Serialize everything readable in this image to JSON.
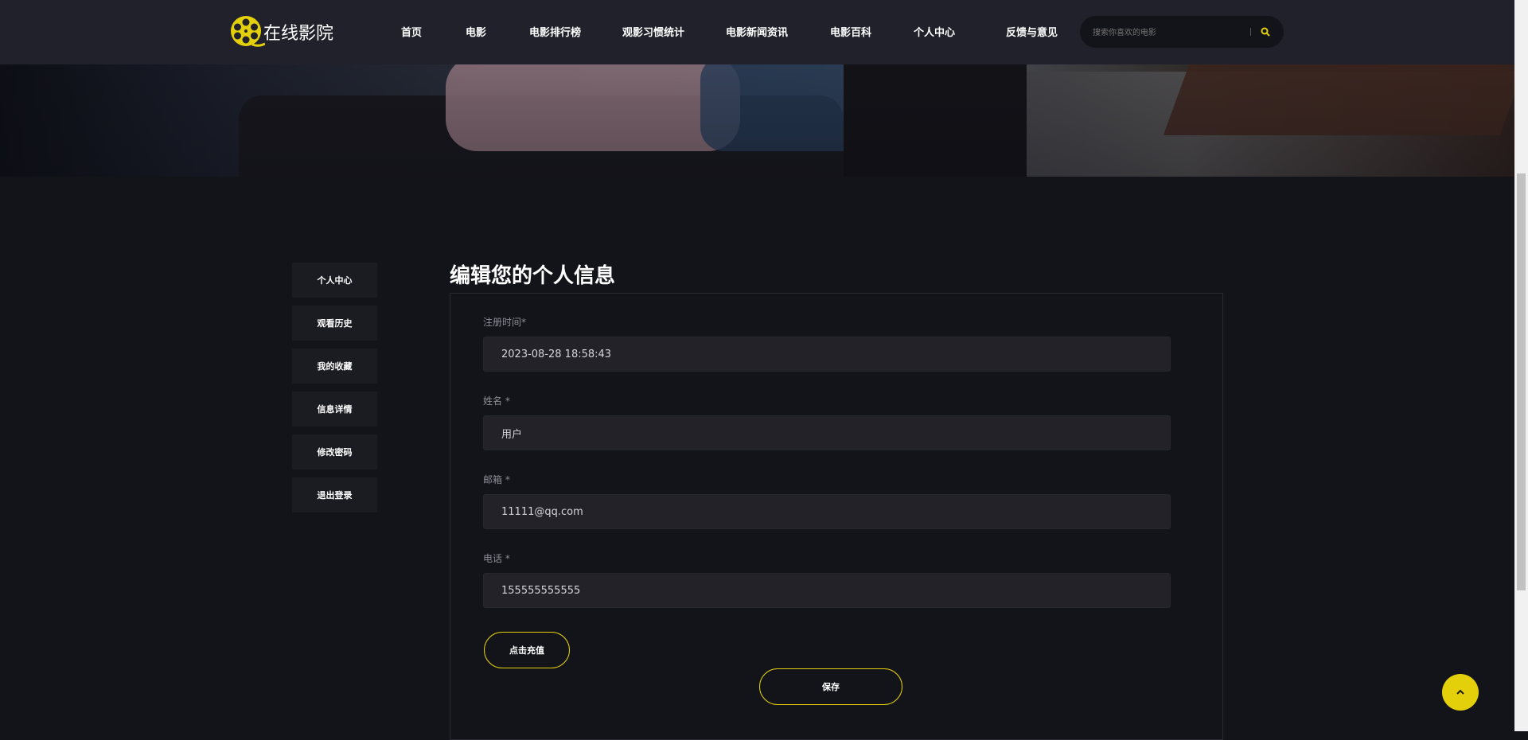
{
  "brand": {
    "name": "在线影院",
    "accent": "#e4d00a"
  },
  "nav": {
    "items": [
      "首页",
      "电影",
      "电影排行榜",
      "观影习惯统计",
      "电影新闻资讯",
      "电影百科",
      "个人中心",
      "反馈与意见"
    ]
  },
  "search": {
    "placeholder": "搜索你喜欢的电影",
    "icon": "search-icon"
  },
  "sidebar": {
    "items": [
      "个人中心",
      "观看历史",
      "我的收藏",
      "信息详情",
      "修改密码",
      "退出登录"
    ]
  },
  "form": {
    "title": "编辑您的个人信息",
    "fields": [
      {
        "label": "注册时间*",
        "value": "2023-08-28 18:58:43"
      },
      {
        "label": "姓名 *",
        "value": "用户"
      },
      {
        "label": "邮箱 *",
        "value": "11111@qq.com"
      },
      {
        "label": "电话 *",
        "value": "155555555555"
      }
    ],
    "recharge_label": "点击充值",
    "save_label": "保存"
  },
  "back_to_top": {
    "icon": "chevron-up-icon"
  }
}
